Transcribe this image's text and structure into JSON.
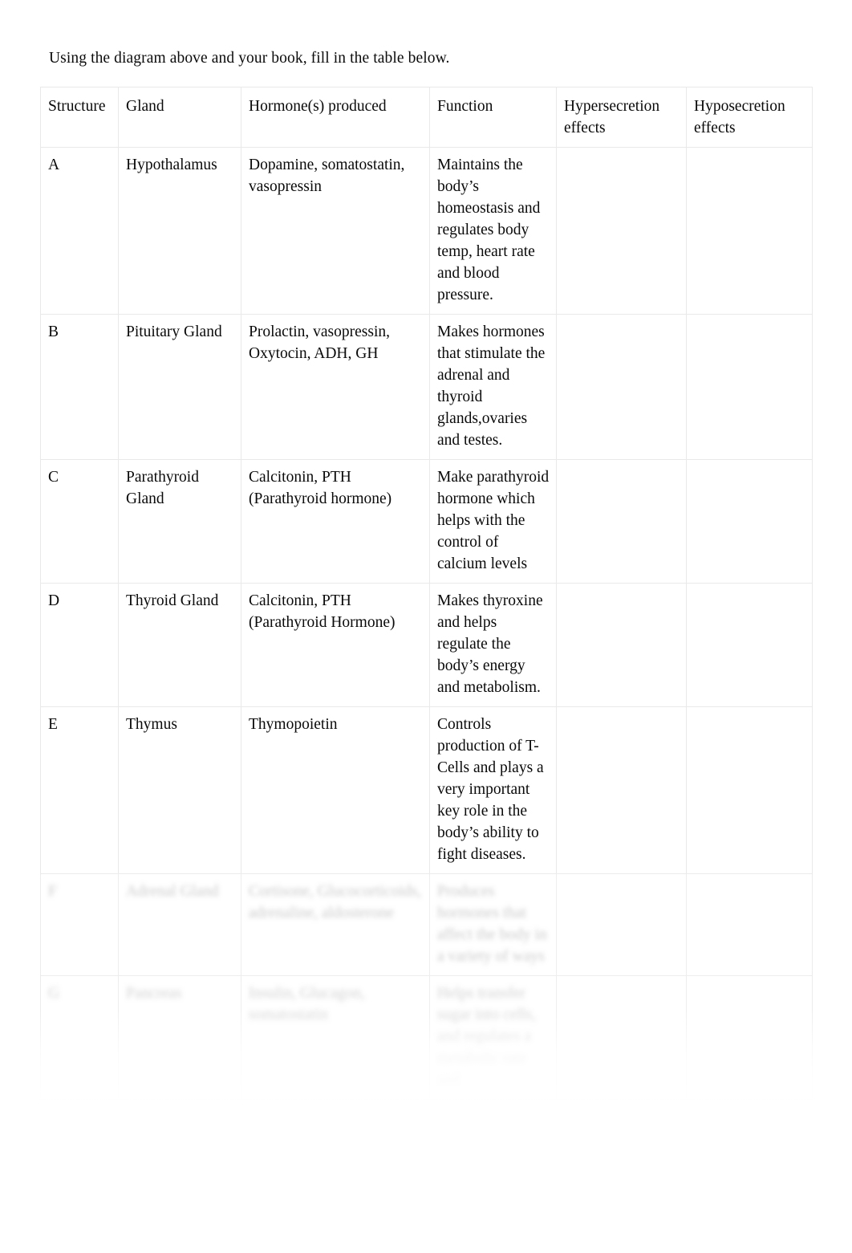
{
  "document": {
    "intro": "Using the diagram above and your book, fill in the table below."
  },
  "table": {
    "headers": [
      "Structure",
      "Gland",
      "Hormone(s) produced",
      "Function",
      "Hypersecretion effects",
      "Hyposecretion effects"
    ],
    "rows": [
      {
        "structure": "A",
        "gland": "Hypothalamus",
        "hormones": "Dopamine, somatostatin, vasopressin",
        "function": "Maintains the body’s homeostasis and regulates body temp, heart rate and blood pressure.",
        "hypersecretion": "",
        "hyposecretion": "",
        "faded": false
      },
      {
        "structure": "B",
        "gland": "Pituitary Gland",
        "hormones": "Prolactin, vasopressin, Oxytocin, ADH, GH",
        "function": "Makes hormones that stimulate the adrenal and thyroid glands,ovaries and testes.",
        "hypersecretion": "",
        "hyposecretion": "",
        "faded": false
      },
      {
        "structure": "C",
        "gland": "Parathyroid Gland",
        "hormones": "Calcitonin, PTH (Parathyroid hormone)",
        "function": "Make parathyroid hormone which helps with the control of calcium levels",
        "hypersecretion": "",
        "hyposecretion": "",
        "faded": false
      },
      {
        "structure": "D",
        "gland": "Thyroid Gland",
        "hormones": "Calcitonin, PTH (Parathyroid Hormone)",
        "function": "Makes thyroxine and helps regulate the body’s energy and metabolism.",
        "hypersecretion": "",
        "hyposecretion": "",
        "faded": false
      },
      {
        "structure": "E",
        "gland": "Thymus",
        "hormones": "Thymopoietin",
        "function": "Controls production of T-Cells and plays a very important key role in the body’s ability to fight diseases.",
        "hypersecretion": "",
        "hyposecretion": "",
        "faded": false
      },
      {
        "structure": "F",
        "gland": "Adrenal Gland",
        "hormones": "Cortisone, Glucocorticoids, adrenaline, aldosterone",
        "function": "Produces hormones that affect the body in a variety of ways",
        "hypersecretion": "",
        "hyposecretion": "",
        "faded": true
      },
      {
        "structure": "G",
        "gland": "Pancreas",
        "hormones": "Insulin, Glucagon, somatostatin",
        "function": "Helps transfer sugar into cells, and regulates a metabolic rate and",
        "hypersecretion": "",
        "hyposecretion": "",
        "faded": true
      }
    ]
  }
}
